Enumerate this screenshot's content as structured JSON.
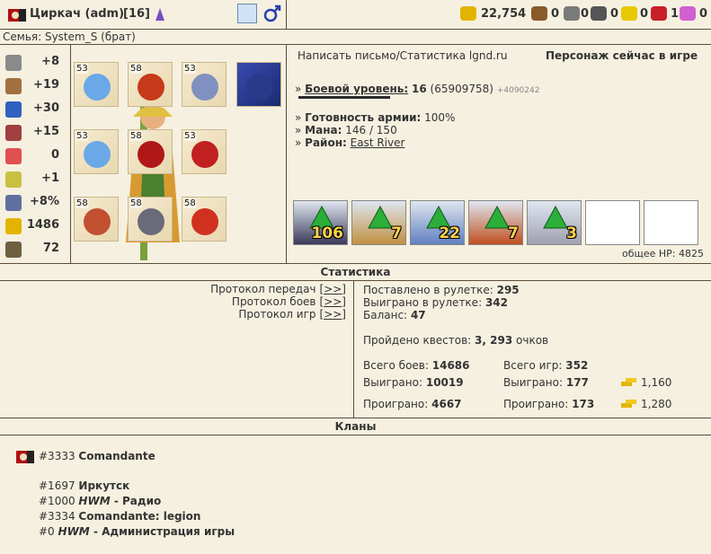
{
  "header": {
    "name": "Циркач (adm)",
    "level": "[16]",
    "resources": [
      {
        "icon": "gold-icon",
        "value": "22,754",
        "color": "#e2b400"
      },
      {
        "icon": "wood-icon",
        "value": "0",
        "color": "#8a5a2b"
      },
      {
        "icon": "ore-icon",
        "value": "0",
        "color": "#7a7a7a"
      },
      {
        "icon": "mercury-icon",
        "value": "0",
        "color": "#555555"
      },
      {
        "icon": "sulfur-icon",
        "value": "0",
        "color": "#e8c800"
      },
      {
        "icon": "crystal-icon",
        "value": "1",
        "color": "#c8202a"
      },
      {
        "icon": "gems-icon",
        "value": "0",
        "color": "#d060d0"
      }
    ]
  },
  "family": "Семья: System_S (брат)",
  "stats": [
    {
      "icon": "attack-icon",
      "value": "+8",
      "color": "#8a8a8a"
    },
    {
      "icon": "defense-icon",
      "value": "+19",
      "color": "#a07040"
    },
    {
      "icon": "spellpower-icon",
      "value": "+30",
      "color": "#3060c0"
    },
    {
      "icon": "knowledge-icon",
      "value": "+15",
      "color": "#a04040"
    },
    {
      "icon": "luck-icon",
      "value": "0",
      "color": "#e05050"
    },
    {
      "icon": "morale-icon",
      "value": "+1",
      "color": "#c8c040"
    },
    {
      "icon": "initiative-icon",
      "value": "+8%",
      "color": "#6070a0"
    },
    {
      "icon": "gold-icon",
      "value": "1486",
      "color": "#e2b400"
    },
    {
      "icon": "scales-icon",
      "value": "72",
      "color": "#706040"
    }
  ],
  "equipment": [
    {
      "level": "53",
      "color": "#6aa8e8"
    },
    {
      "level": "58",
      "color": "#c83a1a"
    },
    {
      "level": "53",
      "color": "#8090c0"
    },
    {
      "level": "",
      "color": "#2a3a8a"
    },
    {
      "level": "53",
      "color": "#6aa8e8"
    },
    {
      "level": "58",
      "color": "#b01818"
    },
    {
      "level": "53",
      "color": "#c02020"
    },
    {
      "level": "58",
      "color": "#c05030"
    },
    {
      "level": "58",
      "color": "#6a6a7a"
    },
    {
      "level": "58",
      "color": "#d03020"
    }
  ],
  "info": {
    "write_link": "Написать письмо",
    "separator": "/",
    "stats_link": "Статистика lgnd.ru",
    "online": "Персонаж сейчас в игре",
    "combat_label": "Боевой уровень:",
    "combat_level": "16",
    "combat_exp": "(65909758)",
    "combat_bonus": "+4090242",
    "army_label": "Готовность армии:",
    "army_value": "100%",
    "mana_label": "Мана:",
    "mana_value": "146 / 150",
    "district_label": "Район:",
    "district_value": "East River",
    "hp_total": "общее HP: 4825"
  },
  "army": [
    {
      "count": "106",
      "color": "#3a3a5a"
    },
    {
      "count": "7",
      "color": "#c09040"
    },
    {
      "count": "22",
      "color": "#6080c0"
    },
    {
      "count": "7",
      "color": "#c05020"
    },
    {
      "count": "3",
      "color": "#a0a0b0"
    },
    {
      "count": "",
      "color": "#ffffff"
    },
    {
      "count": "",
      "color": "#ffffff"
    }
  ],
  "statistics": {
    "heading": "Статистика",
    "links": [
      {
        "label": "Протокол передач",
        "action": "[>>]"
      },
      {
        "label": "Протокол боев",
        "action": "[>>]"
      },
      {
        "label": "Протокол игр",
        "action": "[>>]"
      }
    ],
    "roulette_bet_label": "Поставлено в рулетке:",
    "roulette_bet": "295",
    "roulette_won_label": "Выиграно в рулетке:",
    "roulette_won": "342",
    "balance_label": "Баланс:",
    "balance": "47",
    "quests_label": "Пройдено квестов:",
    "quests": "3, 293",
    "quests_suffix": "очков",
    "battles_total_label": "Всего боев:",
    "battles_total": "14686",
    "games_total_label": "Всего игр:",
    "games_total": "352",
    "battles_won_label": "Выиграно:",
    "battles_won": "10019",
    "games_won_label": "Выиграно:",
    "games_won": "177",
    "gold_won": "1,160",
    "battles_lost_label": "Проиграно:",
    "battles_lost": "4667",
    "games_lost_label": "Проиграно:",
    "games_lost": "173",
    "gold_lost": "1,280"
  },
  "clans": {
    "heading": "Кланы",
    "main": {
      "id": "#3333",
      "name": "Comandante"
    },
    "list": [
      {
        "id": "#1697",
        "name": "Иркутск",
        "prefix": "",
        "suffix": ""
      },
      {
        "id": "#1000",
        "name": "",
        "prefix": "HWM",
        "suffix": " - Радио"
      },
      {
        "id": "#3334",
        "name": "Comandante: legion",
        "prefix": "",
        "suffix": ""
      },
      {
        "id": "#0",
        "name": "",
        "prefix": "HWM",
        "suffix": " - Администрация игры"
      }
    ]
  }
}
